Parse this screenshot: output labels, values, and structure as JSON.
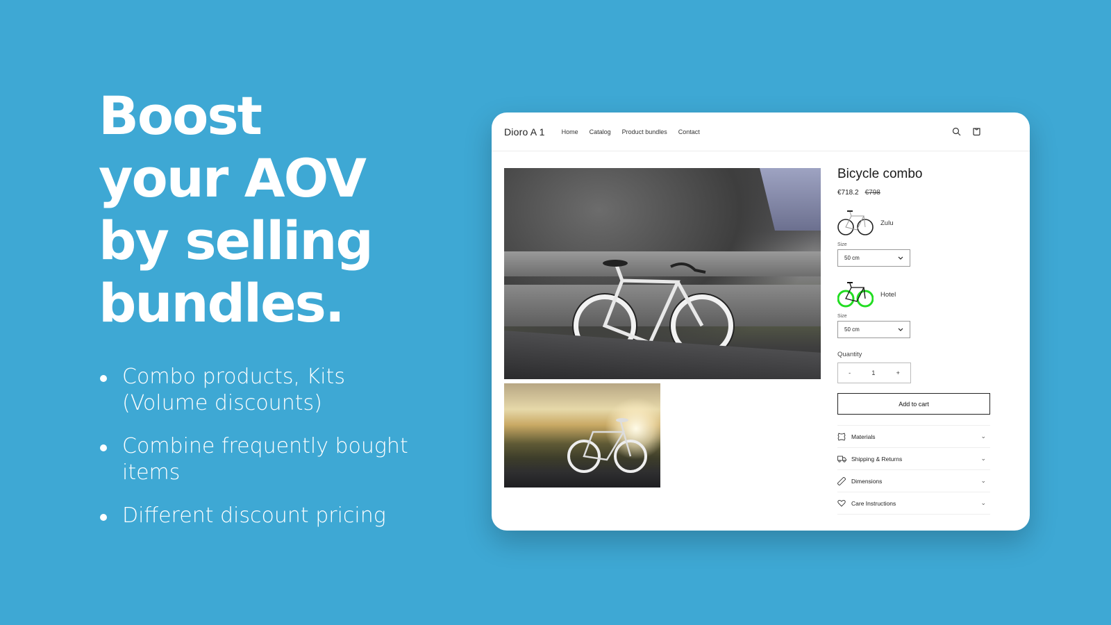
{
  "hero": {
    "title_lines": [
      "Boost",
      "your AOV",
      "by selling",
      "bundles."
    ],
    "bullets": [
      {
        "line1": "Combo products, Kits",
        "line2": "(Volume discounts)"
      },
      {
        "line1": "Combine frequently bought",
        "line2": "items"
      },
      {
        "line1": "Different discount pricing",
        "line2": ""
      }
    ]
  },
  "store": {
    "logo": "Dioro A 1",
    "nav": [
      "Home",
      "Catalog",
      "Product bundles",
      "Contact"
    ],
    "icons": {
      "search": "search-icon",
      "cart": "cart-icon"
    }
  },
  "product": {
    "title": "Bicycle combo",
    "price": "€718.2",
    "compare_price": "€798",
    "variants": [
      {
        "name": "Zulu",
        "size_label": "Size",
        "size_value": "50 cm",
        "accent": "#222222"
      },
      {
        "name": "Hotel",
        "size_label": "Size",
        "size_value": "50 cm",
        "accent": "#22dd22"
      }
    ],
    "quantity_label": "Quantity",
    "quantity_value": "1",
    "quantity_minus": "-",
    "quantity_plus": "+",
    "add_to_cart": "Add to cart",
    "accordion": [
      {
        "label": "Materials",
        "icon": "leather-icon"
      },
      {
        "label": "Shipping & Returns",
        "icon": "truck-icon"
      },
      {
        "label": "Dimensions",
        "icon": "ruler-icon"
      },
      {
        "label": "Care Instructions",
        "icon": "heart-icon"
      }
    ]
  },
  "colors": {
    "background": "#3ea8d4",
    "card": "#ffffff",
    "text_dark": "#1a1a1a"
  }
}
